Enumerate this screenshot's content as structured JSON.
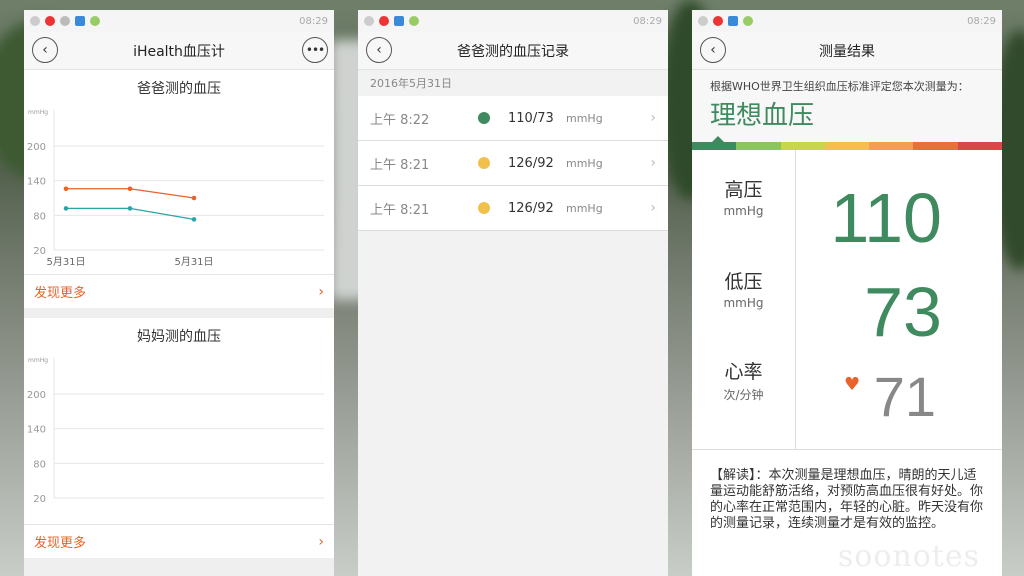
{
  "colors": {
    "accent_orange": "#e8622a",
    "ideal_green": "#3f8a5f",
    "normal_yellow": "#f2c04d",
    "series_sys": "#e8622a",
    "series_dia": "#2aa5a5"
  },
  "status_bar": {
    "time": "08:29"
  },
  "screen1": {
    "title": "iHealth血压计",
    "back_icon": "chevron-left-icon",
    "more_icon": "more-icon",
    "dad_card": {
      "title": "爸爸测的血压",
      "more_label": "发现更多"
    },
    "mom_card": {
      "title": "妈妈测的血压",
      "more_label": "发现更多"
    }
  },
  "chart_data": [
    {
      "type": "line",
      "title": "爸爸测的血压",
      "ylabel": "mmHg",
      "yticks": [
        "200",
        "140",
        "80",
        "20"
      ],
      "x_ticks": [
        "5月31日",
        "5月31日"
      ],
      "ylim": [
        20,
        260
      ],
      "grid": true,
      "series": [
        {
          "values": [
            126,
            126,
            110
          ],
          "color": "#e8622a"
        },
        {
          "values": [
            92,
            92,
            73
          ],
          "color": "#2aa5a5"
        }
      ]
    },
    {
      "type": "line",
      "title": "妈妈测的血压",
      "ylabel": "mmHg",
      "yticks": [
        "200",
        "140",
        "80",
        "20"
      ],
      "x_ticks": [],
      "ylim": [
        20,
        260
      ],
      "grid": true,
      "series": []
    }
  ],
  "screen2": {
    "title": "爸爸测的血压记录",
    "date": "2016年5月31日",
    "records": [
      {
        "time": "上午 8:22",
        "value": "110/73",
        "unit": "mmHg",
        "status_color": "#3f8a5f"
      },
      {
        "time": "上午 8:21",
        "value": "126/92",
        "unit": "mmHg",
        "status_color": "#f2c04d"
      },
      {
        "time": "上午 8:21",
        "value": "126/92",
        "unit": "mmHg",
        "status_color": "#f2c04d"
      }
    ]
  },
  "screen3": {
    "title": "测量结果",
    "who_text": "根据WHO世界卫生组织血压标准评定您本次测量为：",
    "level": "理想血压",
    "scale_colors": [
      "#3f8a5f",
      "#8cc464",
      "#c8d64a",
      "#f2c04d",
      "#f0a050",
      "#e87040",
      "#d84848"
    ],
    "systolic": {
      "label": "高压",
      "unit": "mmHg",
      "value": "110"
    },
    "diastolic": {
      "label": "低压",
      "unit": "mmHg",
      "value": "73"
    },
    "heart_rate": {
      "label": "心率",
      "unit": "次/分钟",
      "value": "71"
    },
    "interpretation": "【解读】：本次测量是理想血压，晴朗的天儿适量运动能舒筋活络，对预防高血压很有好处。你的心率在正常范围内，年轻的心脏。昨天没有你的测量记录，连续测量才是有效的监控。",
    "watermark": "soonotes"
  }
}
